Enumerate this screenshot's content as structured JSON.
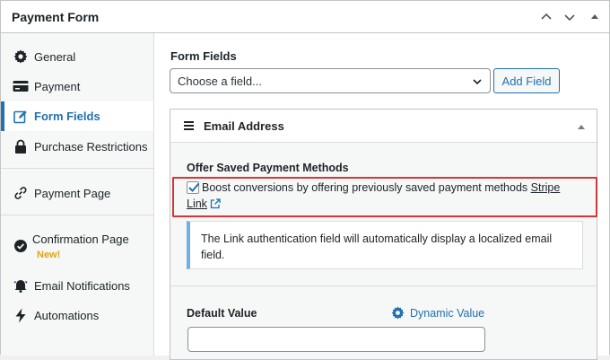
{
  "panel": {
    "title": "Payment Form"
  },
  "sidebar": {
    "items": [
      {
        "label": "General",
        "icon": "gear-icon"
      },
      {
        "label": "Payment",
        "icon": "card-icon"
      },
      {
        "label": "Form Fields",
        "icon": "edit-icon",
        "active": true
      },
      {
        "label": "Purchase Restrictions",
        "icon": "lock-icon"
      },
      {
        "label": "Payment Page",
        "icon": "link-icon"
      },
      {
        "label": "Confirmation Page",
        "icon": "check-badge-icon",
        "badge": "New!"
      },
      {
        "label": "Email Notifications",
        "icon": "bell-icon"
      },
      {
        "label": "Automations",
        "icon": "bolt-icon"
      }
    ]
  },
  "main": {
    "form_fields_label": "Form Fields",
    "select_value": "Choose a field...",
    "add_field_label": "Add Field",
    "card": {
      "title": "Email Address",
      "offer_label": "Offer Saved Payment Methods",
      "checkbox_checked": true,
      "checkbox_text": "Boost conversions by offering previously saved payment methods",
      "link_text": "Stripe Link",
      "notice_text": "The Link authentication field will automatically display a localized email field.",
      "default_value_label": "Default Value",
      "dynamic_value_label": "Dynamic Value",
      "default_value": ""
    }
  },
  "colors": {
    "accent": "#2271b1",
    "highlight": "#d63638",
    "badge": "#dba617",
    "notice_border": "#72aee6"
  }
}
